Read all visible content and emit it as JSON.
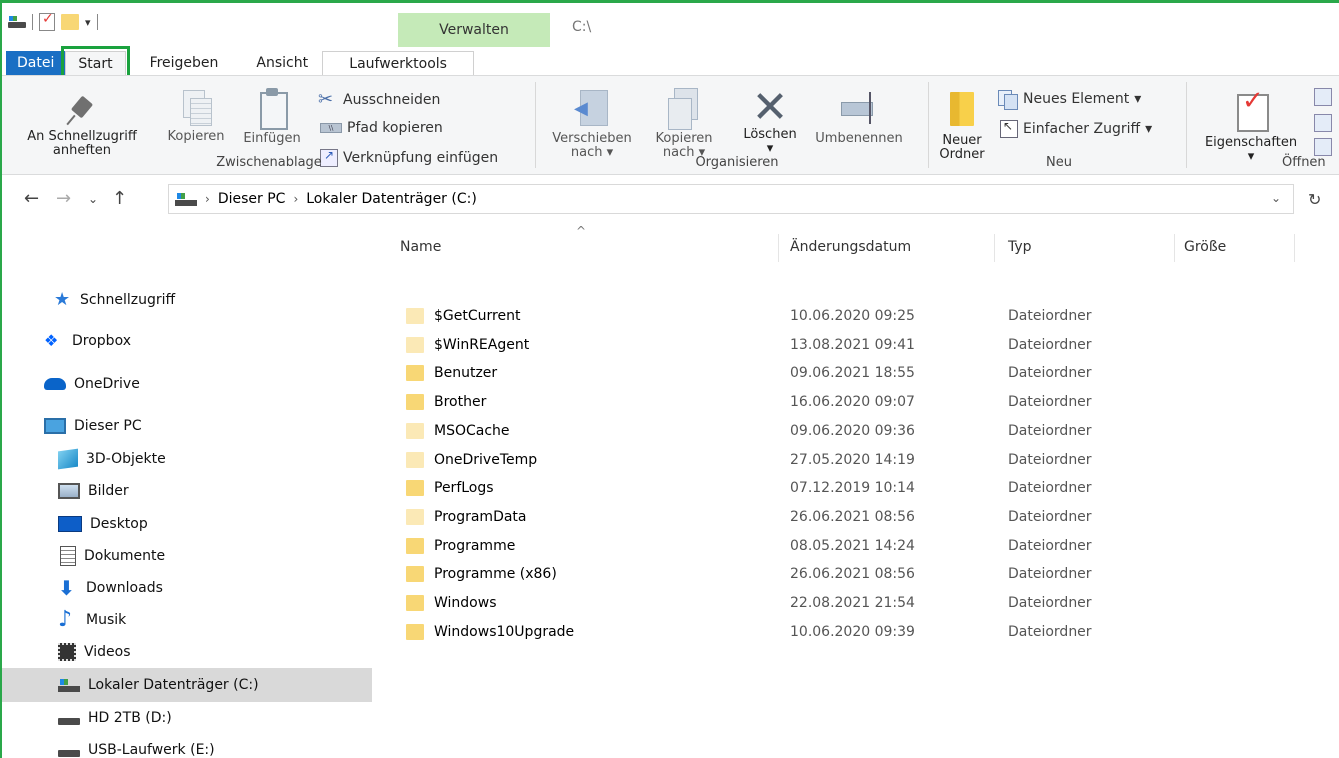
{
  "window": {
    "context_tab": "Verwalten",
    "title": "C:\\"
  },
  "ribbon_tabs": [
    {
      "label": "Datei"
    },
    {
      "label": "Start"
    },
    {
      "label": "Freigeben"
    },
    {
      "label": "Ansicht"
    },
    {
      "label": "Laufwerktools"
    }
  ],
  "ribbon": {
    "zwischenablage": {
      "label": "Zwischenablage",
      "pin_line1": "An Schnellzugriff",
      "pin_line2": "anheften",
      "copy": "Kopieren",
      "paste": "Einfügen",
      "cut": "Ausschneiden",
      "copy_path": "Pfad kopieren",
      "paste_link": "Verknüpfung einfügen"
    },
    "organisieren": {
      "label": "Organisieren",
      "move_line1": "Verschieben",
      "move_line2": "nach",
      "copyto_line1": "Kopieren",
      "copyto_line2": "nach",
      "delete": "Löschen",
      "rename": "Umbenennen"
    },
    "neu": {
      "label": "Neu",
      "new_folder_line1": "Neuer",
      "new_folder_line2": "Ordner",
      "new_item": "Neues Element",
      "easy_access": "Einfacher Zugriff"
    },
    "oeffnen": {
      "label": "Öffnen",
      "properties": "Eigenschaften"
    }
  },
  "address": {
    "crumbs": [
      "Dieser PC",
      "Lokaler Datenträger (C:)"
    ]
  },
  "nav": [
    {
      "label": "Schnellzugriff",
      "icon": "star-icon"
    },
    {
      "label": "Dropbox",
      "icon": "dropbox-icon"
    },
    {
      "label": "OneDrive",
      "icon": "onedrive-icon"
    },
    {
      "label": "Dieser PC",
      "icon": "pc-icon"
    },
    {
      "label": "3D-Objekte",
      "icon": "cube-icon"
    },
    {
      "label": "Bilder",
      "icon": "pictures-icon"
    },
    {
      "label": "Desktop",
      "icon": "desktop-icon"
    },
    {
      "label": "Dokumente",
      "icon": "documents-icon"
    },
    {
      "label": "Downloads",
      "icon": "download-icon"
    },
    {
      "label": "Musik",
      "icon": "music-icon"
    },
    {
      "label": "Videos",
      "icon": "video-icon"
    },
    {
      "label": "Lokaler Datenträger (C:)",
      "icon": "drive-c-icon",
      "selected": true
    },
    {
      "label": "HD 2TB (D:)",
      "icon": "drive-icon"
    },
    {
      "label": "USB-Laufwerk (E:)",
      "icon": "drive-icon"
    }
  ],
  "columns": {
    "name": "Name",
    "date": "Änderungsdatum",
    "type": "Typ",
    "size": "Größe"
  },
  "files": [
    {
      "name": "$GetCurrent",
      "date": "10.06.2020 09:25",
      "type": "Dateiordner",
      "hidden": true
    },
    {
      "name": "$WinREAgent",
      "date": "13.08.2021 09:41",
      "type": "Dateiordner",
      "hidden": true
    },
    {
      "name": "Benutzer",
      "date": "09.06.2021 18:55",
      "type": "Dateiordner",
      "hidden": false
    },
    {
      "name": "Brother",
      "date": "16.06.2020 09:07",
      "type": "Dateiordner",
      "hidden": false
    },
    {
      "name": "MSOCache",
      "date": "09.06.2020 09:36",
      "type": "Dateiordner",
      "hidden": true
    },
    {
      "name": "OneDriveTemp",
      "date": "27.05.2020 14:19",
      "type": "Dateiordner",
      "hidden": true
    },
    {
      "name": "PerfLogs",
      "date": "07.12.2019 10:14",
      "type": "Dateiordner",
      "hidden": false
    },
    {
      "name": "ProgramData",
      "date": "26.06.2021 08:56",
      "type": "Dateiordner",
      "hidden": true
    },
    {
      "name": "Programme",
      "date": "08.05.2021 14:24",
      "type": "Dateiordner",
      "hidden": false
    },
    {
      "name": "Programme (x86)",
      "date": "26.06.2021 08:56",
      "type": "Dateiordner",
      "hidden": false
    },
    {
      "name": "Windows",
      "date": "22.08.2021 21:54",
      "type": "Dateiordner",
      "hidden": false
    },
    {
      "name": "Windows10Upgrade",
      "date": "10.06.2020 09:39",
      "type": "Dateiordner",
      "hidden": false
    }
  ]
}
